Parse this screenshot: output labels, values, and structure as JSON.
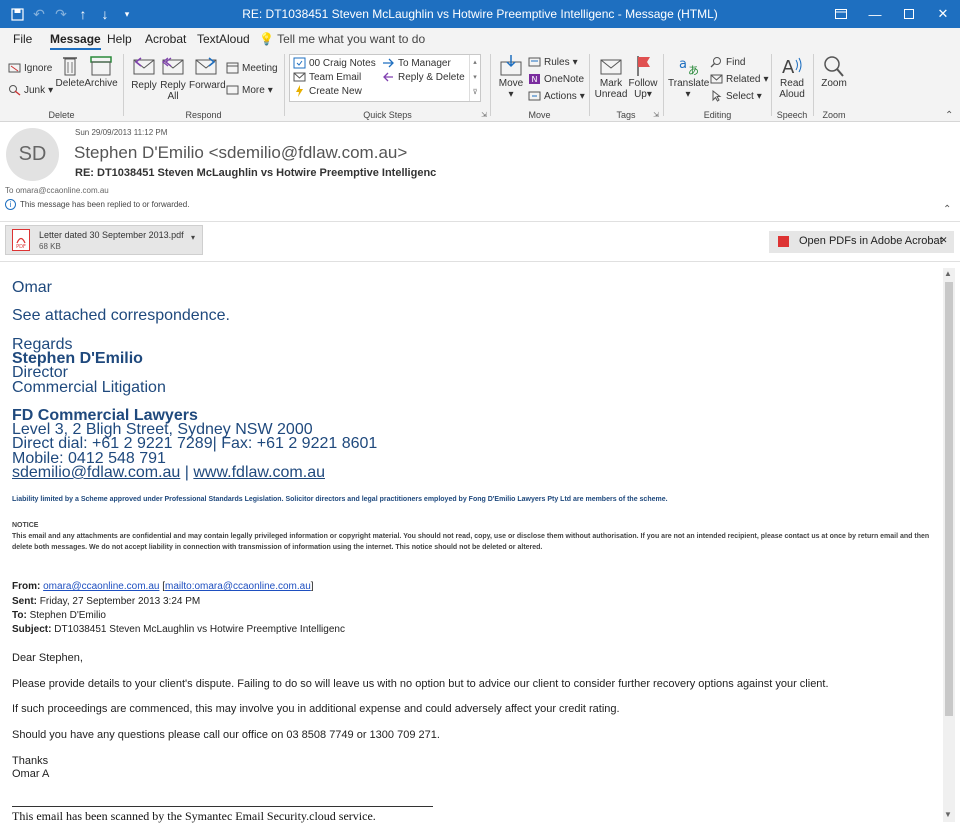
{
  "window": {
    "title": "RE: DT1038451 Steven McLaughlin vs Hotwire Preemptive Intelligenc  -  Message (HTML)",
    "controls": [
      "restore-ribbon",
      "minimize",
      "maximize",
      "close"
    ]
  },
  "menu": {
    "items": [
      "File",
      "Message",
      "Help",
      "Acrobat",
      "TextAloud"
    ],
    "active": "Message",
    "tell_me": "Tell me what you want to do"
  },
  "ribbon": {
    "delete": {
      "label": "Delete",
      "ignore": "Ignore",
      "junk": "Junk",
      "delete": "Delete",
      "archive": "Archive"
    },
    "respond": {
      "label": "Respond",
      "reply": "Reply",
      "reply_all_1": "Reply",
      "reply_all_2": "All",
      "forward": "Forward",
      "meeting": "Meeting",
      "more": "More"
    },
    "quick_steps": {
      "label": "Quick Steps",
      "items": [
        "00 Craig Notes",
        "To Manager",
        "Team Email",
        "Reply & Delete",
        "Create New"
      ]
    },
    "move": {
      "label": "Move",
      "move": "Move",
      "rules": "Rules",
      "onenote": "OneNote",
      "actions": "Actions"
    },
    "tags": {
      "label": "Tags",
      "mark_1": "Mark",
      "mark_2": "Unread",
      "follow_1": "Follow",
      "follow_2": "Up"
    },
    "editing": {
      "label": "Editing",
      "translate": "Translate",
      "find": "Find",
      "related": "Related",
      "select": "Select"
    },
    "speech": {
      "label": "Speech",
      "read_1": "Read",
      "read_2": "Aloud"
    },
    "zoom": {
      "label": "Zoom",
      "zoom": "Zoom"
    }
  },
  "message": {
    "avatar_initials": "SD",
    "date": "Sun 29/09/2013 11:12 PM",
    "from": "Stephen D'Emilio <sdemilio@fdlaw.com.au>",
    "subject": "RE: DT1038451 Steven McLaughlin vs Hotwire Preemptive Intelligenc",
    "to_label": "To",
    "to": "omara@ccaonline.com.au",
    "info": "This message has been replied to or forwarded."
  },
  "attachment": {
    "name": "Letter dated 30 September 2013.pdf",
    "size": "68 KB"
  },
  "open_pdfs": "Open PDFs in Adobe Acrobat",
  "body": {
    "greeting": "Omar",
    "line1": "See attached correspondence.",
    "regards": "Regards",
    "sig_name": "Stephen D'Emilio",
    "sig_title": "Director",
    "sig_dept": "Commercial Litigation",
    "firm": "FD Commercial Lawyers",
    "address": "Level 3, 2 Bligh Street, Sydney NSW 2000",
    "phones": "Direct dial: +61 2 9221 7289| Fax: +61 2 9221 8601",
    "mobile": "Mobile: 0412 548 791",
    "email": "sdemilio@fdlaw.com.au",
    "sep": "|",
    "web": "www.fdlaw.com.au",
    "liability": "Liability limited by a Scheme approved under Professional Standards Legislation. Solicitor directors and legal practitioners employed by Fong D'Emilio Lawyers Pty Ltd are members of the scheme.",
    "notice_title": "NOTICE",
    "notice1": "This email and any attachments are confidential and may contain legally privileged information or copyright material. You should not read, copy, use or disclose them without authorisation. If you are not an intended recipient, please contact us at once by return email and then",
    "notice2": "delete both messages. We do not accept liability in connection with transmission of information using the internet. This notice should not be deleted or altered.",
    "fw_from_label": "From:",
    "fw_from_email": "omara@ccaonline.com.au",
    "fw_from_mailto": "mailto:omara@ccaonline.com.au",
    "fw_sent_label": "Sent:",
    "fw_sent": "Friday, 27 September 2013 3:24 PM",
    "fw_to_label": "To:",
    "fw_to": "Stephen D'Emilio",
    "fw_subject_label": "Subject:",
    "fw_subject": "DT1038451 Steven McLaughlin vs Hotwire Preemptive Intelligenc",
    "dear": "Dear Stephen,",
    "p1": "Please provide details to your client's dispute. Failing to do so will leave us with no option but to advice our client to consider further recovery options against your client.",
    "p2": "If such proceedings are commenced, this may involve you in additional expense and could adversely affect your credit rating.",
    "p3": "Should you have any questions please call our office on 03 8508 7749 or 1300 709 271.",
    "thanks": "Thanks",
    "omar": "Omar A",
    "scanned": "This email has been scanned by the Symantec Email Security.cloud service."
  }
}
